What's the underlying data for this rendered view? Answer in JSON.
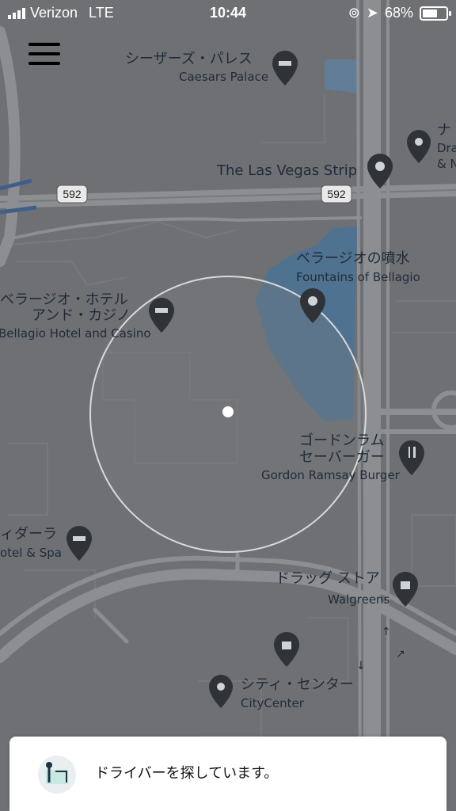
{
  "status_bar": {
    "carrier": "Verizon",
    "network": "LTE",
    "time": "10:44",
    "battery": "68%",
    "battery_level": 0.68
  },
  "map": {
    "route_badges": [
      "592",
      "592"
    ],
    "places": [
      {
        "ja": "シーザーズ・パレス",
        "en": "Caesars Palace",
        "icon": "hotel-icon"
      },
      {
        "ja": "",
        "en": "The Las Vegas Strip",
        "icon": "camera-icon"
      },
      {
        "ja": "ナ",
        "en": "Dra",
        "en2": "& N",
        "icon": "place-icon"
      },
      {
        "ja": "ベラージオの噴水",
        "en": "Fountains of Bellagio",
        "icon": "camera-icon"
      },
      {
        "ja": "ベラージオ・ホテル",
        "ja2": "アンド・カジノ",
        "en": "Bellagio Hotel and Casino",
        "icon": "hotel-icon"
      },
      {
        "ja": "ゴードンラム",
        "ja2": "セーバーガー",
        "en": "Gordon Ramsay Burger",
        "icon": "restaurant-icon"
      },
      {
        "ja": "ィダーラ",
        "en": "otel & Spa",
        "icon": "hotel-icon"
      },
      {
        "ja": "ドラッグ ストア",
        "en": "Walgreens",
        "icon": "shopping-icon"
      },
      {
        "ja": "シティ・センター",
        "en": "CityCenter",
        "icon": "place-icon"
      }
    ]
  },
  "bottom_sheet": {
    "status_text": "ドライバーを探しています。"
  }
}
